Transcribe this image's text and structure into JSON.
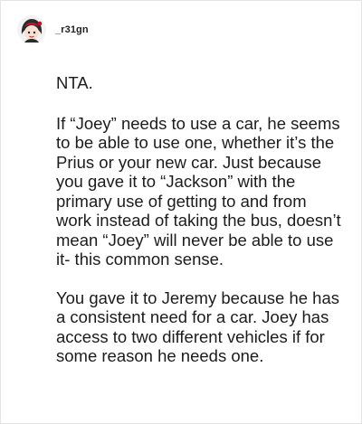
{
  "comment": {
    "username": "_r31gn",
    "paragraphs": [
      "NTA.",
      "If “Joey” needs to use a car, he seems to be able to use one, whether it’s the Prius or your new car. Just because you gave it to “Jackson” with the primary use of getting to and from work instead of taking the bus, doesn’t mean “Joey” will never be able to use it- this common sense.",
      "You gave it to Jeremy because he has a consistent need for a car. Joey has access to two different vehicles if for some reason he needs one."
    ]
  }
}
